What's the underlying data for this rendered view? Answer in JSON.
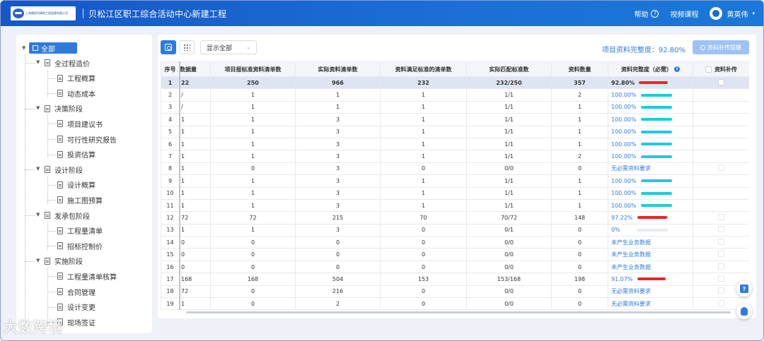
{
  "header": {
    "logo_text": "上海唐舒科建筑工程监理有限公司",
    "project_title": "贝松江区职工综合活动中心新建工程",
    "help_label": "帮助",
    "help_icon": "?",
    "video_label": "视频课程",
    "user_name": "黄英伟",
    "caret": "▾"
  },
  "sidebar": {
    "root_label": "全部",
    "root_arrow": "▼",
    "groups": [
      {
        "label": "全过程造价",
        "arrow": "▼",
        "children": [
          "工程概算",
          "动态成本"
        ]
      },
      {
        "label": "决策阶段",
        "arrow": "▼",
        "children": [
          "项目建议书",
          "可行性研究报告",
          "投资估算"
        ]
      },
      {
        "label": "设计阶段",
        "arrow": "▼",
        "children": [
          "设计概算",
          "施工图预算"
        ]
      },
      {
        "label": "发承包阶段",
        "arrow": "▼",
        "children": [
          "工程量清单",
          "招标控制价"
        ]
      },
      {
        "label": "实施阶段",
        "arrow": "▼",
        "children": [
          "工程量清单核算",
          "合同管理",
          "设计变更",
          "现场签证"
        ]
      }
    ]
  },
  "toolbar": {
    "filter_value": "显示全部",
    "filter_chevron": "⌄",
    "completeness_label": "项目资料完整度：92.80%",
    "supplement_button": "资料补传提醒"
  },
  "table": {
    "headers": [
      "序号",
      "数据量",
      "项目报标准资料清单数",
      "实际资料清单数",
      "资料满足标准的清单数",
      "实际匹配标准数",
      "资料数量",
      "资料完整度（必需）",
      "资料补传"
    ],
    "info_icon": "i",
    "rows": [
      {
        "idx": "1",
        "qty": "22",
        "a": "250",
        "b": "966",
        "c": "232",
        "d": "232/250",
        "e": "357",
        "pct": "92.80%",
        "kind": "bar",
        "fill": 0.928,
        "color": "#e8262c",
        "sel": true
      },
      {
        "idx": "2",
        "qty": "/",
        "a": "1",
        "b": "1",
        "c": "1",
        "d": "1/1",
        "e": "2",
        "pct": "100.00%",
        "kind": "bar",
        "fill": 1.0,
        "color": "#1fc9e0"
      },
      {
        "idx": "3",
        "qty": "/",
        "a": "1",
        "b": "1",
        "c": "1",
        "d": "1/1",
        "e": "1",
        "pct": "100.00%",
        "kind": "bar",
        "fill": 1.0,
        "color": "#1fc9e0"
      },
      {
        "idx": "4",
        "qty": "1",
        "a": "1",
        "b": "3",
        "c": "1",
        "d": "1/1",
        "e": "1",
        "pct": "100.00%",
        "kind": "bar",
        "fill": 1.0,
        "color": "#1fc9e0"
      },
      {
        "idx": "5",
        "qty": "1",
        "a": "1",
        "b": "3",
        "c": "1",
        "d": "1/1",
        "e": "1",
        "pct": "100.00%",
        "kind": "bar",
        "fill": 1.0,
        "color": "#1fc9e0"
      },
      {
        "idx": "6",
        "qty": "1",
        "a": "1",
        "b": "3",
        "c": "1",
        "d": "1/1",
        "e": "1",
        "pct": "100.00%",
        "kind": "bar",
        "fill": 1.0,
        "color": "#1fc9e0"
      },
      {
        "idx": "7",
        "qty": "1",
        "a": "1",
        "b": "3",
        "c": "1",
        "d": "1/1",
        "e": "2",
        "pct": "100.00%",
        "kind": "bar",
        "fill": 1.0,
        "color": "#1fc9e0"
      },
      {
        "idx": "8",
        "qty": "1",
        "a": "0",
        "b": "3",
        "c": "0",
        "d": "0/0",
        "e": "0",
        "pct": "无必需资料要求",
        "kind": "text"
      },
      {
        "idx": "9",
        "qty": "1",
        "a": "1",
        "b": "3",
        "c": "1",
        "d": "1/1",
        "e": "1",
        "pct": "100.00%",
        "kind": "bar",
        "fill": 1.0,
        "color": "#1fc9e0"
      },
      {
        "idx": "10",
        "qty": "1",
        "a": "1",
        "b": "3",
        "c": "1",
        "d": "1/1",
        "e": "1",
        "pct": "100.00%",
        "kind": "bar",
        "fill": 1.0,
        "color": "#1fc9e0"
      },
      {
        "idx": "11",
        "qty": "1",
        "a": "1",
        "b": "3",
        "c": "1",
        "d": "1/1",
        "e": "1",
        "pct": "100.00%",
        "kind": "bar",
        "fill": 1.0,
        "color": "#1fc9e0"
      },
      {
        "idx": "12",
        "qty": "72",
        "a": "72",
        "b": "215",
        "c": "70",
        "d": "70/72",
        "e": "148",
        "pct": "97.22%",
        "kind": "bar",
        "fill": 0.9722,
        "color": "#e8262c"
      },
      {
        "idx": "13",
        "qty": "1",
        "a": "1",
        "b": "3",
        "c": "0",
        "d": "0/1",
        "e": "0",
        "pct": "0%",
        "kind": "bar",
        "fill": 0.0,
        "color": "#1fc9e0"
      },
      {
        "idx": "14",
        "qty": "0",
        "a": "0",
        "b": "0",
        "c": "0",
        "d": "0/0",
        "e": "0",
        "pct": "未产生业务数据",
        "kind": "text"
      },
      {
        "idx": "15",
        "qty": "0",
        "a": "0",
        "b": "0",
        "c": "0",
        "d": "0/0",
        "e": "0",
        "pct": "未产生业务数据",
        "kind": "text"
      },
      {
        "idx": "16",
        "qty": "0",
        "a": "0",
        "b": "0",
        "c": "0",
        "d": "0/0",
        "e": "0",
        "pct": "未产生业务数据",
        "kind": "text"
      },
      {
        "idx": "17",
        "qty": "168",
        "a": "168",
        "b": "504",
        "c": "153",
        "d": "153/168",
        "e": "198",
        "pct": "91.07%",
        "kind": "bar",
        "fill": 0.9107,
        "color": "#e8262c"
      },
      {
        "idx": "18",
        "qty": "72",
        "a": "0",
        "b": "216",
        "c": "0",
        "d": "0/0",
        "e": "0",
        "pct": "无必需资料要求",
        "kind": "text"
      },
      {
        "idx": "19",
        "qty": "1",
        "a": "0",
        "b": "2",
        "c": "0",
        "d": "0/0",
        "e": "0",
        "pct": "无必需资料要求",
        "kind": "text"
      }
    ]
  },
  "floating": {
    "help_badge": "?"
  },
  "watermark": "大数跨境",
  "colors": {
    "accent": "#2e7be0",
    "header": "#1657c7",
    "bar_red": "#e8262c",
    "bar_cyan": "#1fc9e0"
  }
}
